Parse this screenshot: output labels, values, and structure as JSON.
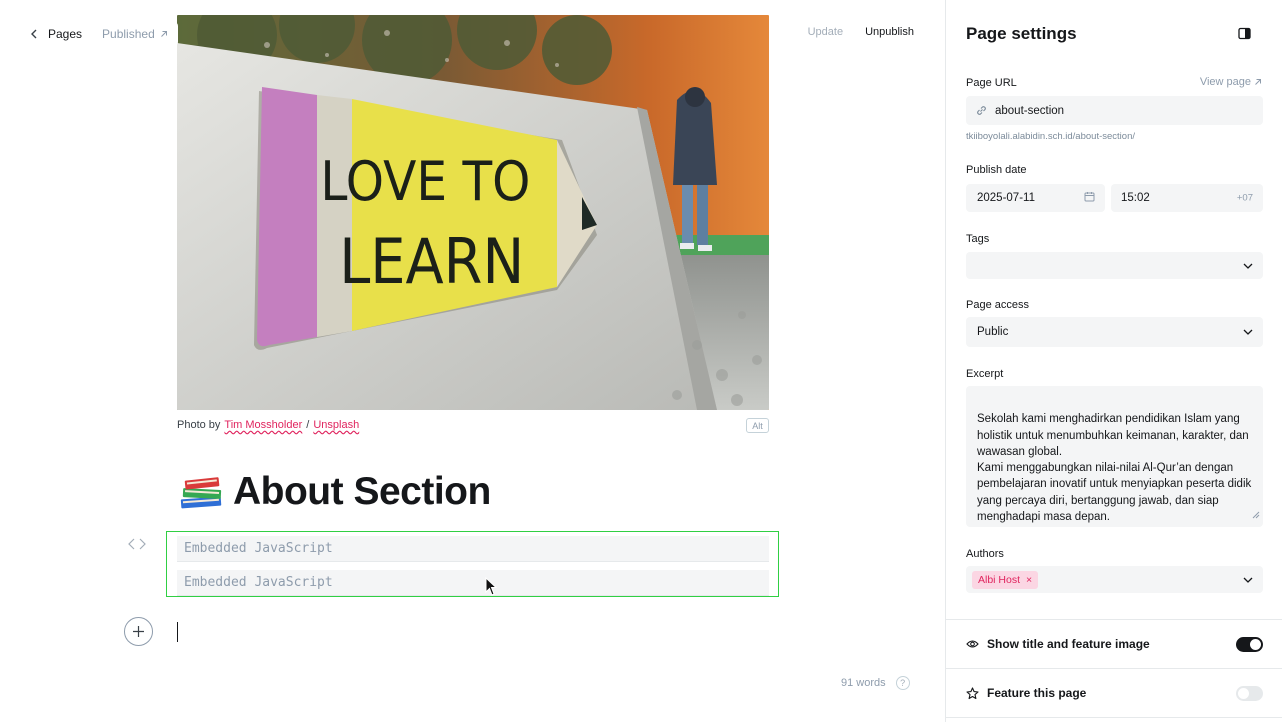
{
  "topbar": {
    "back_label": "Pages",
    "status_label": "Published",
    "update_label": "Update",
    "unpublish_label": "Unpublish"
  },
  "feature_image": {
    "sign_line1": "LOVE TO",
    "sign_line2": "LEARN",
    "caption_prefix": "Photo by",
    "caption_author": "Tim Mossholder",
    "caption_sep": "/",
    "caption_source": "Unsplash",
    "alt_label": "Alt"
  },
  "post": {
    "title": "About Section",
    "embeds": [
      "Embedded JavaScript",
      "Embedded JavaScript"
    ],
    "word_count": "91 words",
    "help_glyph": "?"
  },
  "settings": {
    "title": "Page settings",
    "page_url_label": "Page URL",
    "view_page_label": "View page",
    "page_url_value": "about-section",
    "page_url_full": "tkiiboyolali.alabidin.sch.id/about-section/",
    "publish_date_label": "Publish date",
    "date_value": "2025-07-11",
    "time_value": "15:02",
    "timezone": "+07",
    "tags_label": "Tags",
    "tags_value": "",
    "access_label": "Page access",
    "access_value": "Public",
    "excerpt_label": "Excerpt",
    "excerpt_value": "Sekolah kami menghadirkan pendidikan Islam yang holistik untuk menumbuhkan keimanan, karakter, dan wawasan global.\nKami menggabungkan nilai-nilai Al-Qur’an dengan pembelajaran inovatif untuk menyiapkan peserta didik yang percaya diri, bertanggung jawab, dan siap menghadapi masa depan.",
    "authors_label": "Authors",
    "author_chip": "Albi Host",
    "author_remove_glyph": "×",
    "show_title_label": "Show title and feature image",
    "show_title_on": true,
    "feature_label": "Feature this page",
    "feature_on": false
  },
  "colors": {
    "accent_pink": "#e0245e",
    "embed_border": "#30cf43",
    "text": "#15171a",
    "muted": "#8e9cac"
  }
}
